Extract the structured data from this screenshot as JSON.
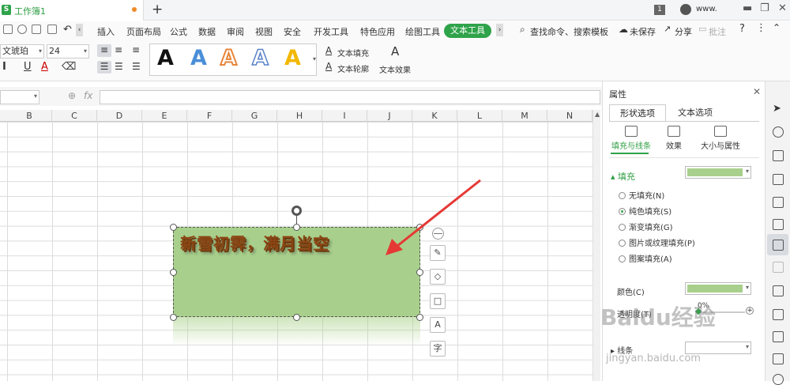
{
  "titlebar": {
    "doc_tab": "工作簿1",
    "new_tab": "+",
    "window_count": "1",
    "user_name": "www."
  },
  "menu": {
    "items": [
      "插入",
      "页面布局",
      "公式",
      "数据",
      "审阅",
      "视图",
      "安全",
      "开发工具",
      "特色应用",
      "绘图工具"
    ],
    "active": "文本工具",
    "search_placeholder": "查找命令、搜索模板",
    "unsaved": "未保存",
    "share": "分享",
    "annotate": "批注"
  },
  "toolbar": {
    "font_name": "文琥珀",
    "font_size": "24",
    "wordart_letters": [
      "A",
      "A",
      "A",
      "A",
      "A"
    ],
    "text_fill": "文本填充",
    "text_outline": "文本轮廓",
    "text_effects": "文本效果"
  },
  "formula": {
    "fx": "fx"
  },
  "columns": [
    "B",
    "C",
    "D",
    "E",
    "F",
    "G",
    "H",
    "I",
    "J",
    "K",
    "L",
    "M",
    "N"
  ],
  "textbox": {
    "text": "新雪初霁，满月当空"
  },
  "float_buttons": [
    "—",
    "✎",
    "◇",
    "□",
    "A",
    "字"
  ],
  "pane": {
    "title": "属性",
    "tabs": [
      "形状选项",
      "文本选项"
    ],
    "subtabs": [
      "填充与线条",
      "效果",
      "大小与属性"
    ],
    "fill_section": "填充",
    "fill_options": [
      "无填充(N)",
      "纯色填充(S)",
      "渐变填充(G)",
      "图片或纹理填充(P)",
      "图案填充(A)"
    ],
    "selected_fill": "纯色填充(S)",
    "color_label": "颜色(C)",
    "transparency_label": "透明度(T)",
    "transparency_value": "0%",
    "line_section": "线条",
    "fill_color": "#a8d08c"
  },
  "watermark": {
    "logo": "Baidu经验",
    "url": "jingyan.baidu.com"
  }
}
